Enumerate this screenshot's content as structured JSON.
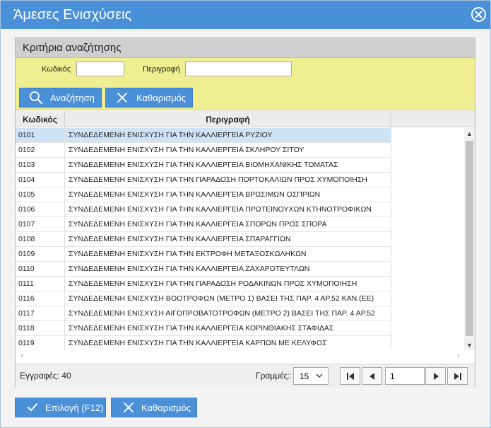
{
  "window": {
    "title": "Άμεσες Ενισχύσεις"
  },
  "criteria": {
    "header": "Κριτήρια αναζήτησης",
    "code_label": "Κωδικός",
    "code_value": "",
    "desc_label": "Περιγραφή",
    "desc_value": "",
    "search_button": "Αναζήτηση",
    "clear_button": "Καθαρισμός"
  },
  "grid": {
    "columns": [
      "Κωδικός",
      "Περιγραφή"
    ],
    "rows": [
      [
        "0101",
        "ΣΥΝΔΕΔΕΜΕΝΗ ΕΝΙΣΧΥΣΗ ΓΙΑ ΤΗΝ ΚΑΛΛΙΕΡΓΕΙΑ ΡΥΖΙΟΥ"
      ],
      [
        "0102",
        "ΣΥΝΔΕΔΕΜΕΝΗ ΕΝΙΣΧΥΣΗ ΓΙΑ ΤΗΝ ΚΑΛΛΙΕΡΓΕΙΑ ΣΚΛΗΡΟΥ ΣΙΤΟΥ"
      ],
      [
        "0103",
        "ΣΥΝΔΕΔΕΜΕΝΗ ΕΝΙΣΧΥΣΗ ΓΙΑ ΤΗΝ ΚΑΛΛΙΕΡΓΕΙΑ ΒΙΟΜΗΧΑΝΙΚΗΣ ΤΟΜΑΤΑΣ"
      ],
      [
        "0104",
        "ΣΥΝΔΕΔΕΜΕΝΗ ΕΝΙΣΧΥΣΗ ΓΙΑ ΤΗΝ ΠΑΡΑΔΟΣΗ ΠΟΡΤΟΚΑΛΙΩΝ ΠΡΟΣ ΧΥΜΟΠΟΙΗΣΗ"
      ],
      [
        "0105",
        "ΣΥΝΔΕΔΕΜΕΝΗ ΕΝΙΣΧΥΣΗ ΓΙΑ ΤΗΝ ΚΑΛΛΙΕΡΓΕΙΑ ΒΡΩΣΙΜΩΝ ΟΣΠΡΙΩΝ"
      ],
      [
        "0106",
        "ΣΥΝΔΕΔΕΜΕΝΗ ΕΝΙΣΧΥΣΗ ΓΙΑ ΤΗΝ ΚΑΛΛΙΕΡΓΕΙΑ ΠΡΩΤΕΙΝΟΥΧΩΝ ΚΤΗΝΟΤΡΟΦΙΚΩΝ"
      ],
      [
        "0107",
        "ΣΥΝΔΕΔΕΜΕΝΗ ΕΝΙΣΧΥΣΗ ΓΙΑ ΤΗΝ ΚΑΛΛΙΕΡΓΕΙΑ ΣΠΟΡΩΝ ΠΡΟΣ ΣΠΟΡΑ"
      ],
      [
        "0108",
        "ΣΥΝΔΕΔΕΜΕΝΗ ΕΝΙΣΧΥΣΗ ΓΙΑ ΤΗΝ ΚΑΛΛΙΕΡΓΕΙΑ ΣΠΑΡΑΓΓΙΩΝ"
      ],
      [
        "0109",
        "ΣΥΝΔΕΔΕΜΕΝΗ ΕΝΙΣΧΥΣΗ ΓΙΑ ΤΗΝ ΕΚΤΡΟΦΗ ΜΕΤΑΞΟΣΚΩΛΗΚΩΝ"
      ],
      [
        "0110",
        "ΣΥΝΔΕΔΕΜΕΝΗ ΕΝΙΣΧΥΣΗ ΓΙΑ ΤΗΝ ΚΑΛΛΙΕΡΓΕΙΑ ΖΑΧΑΡΟΤΕΥΤΛΩΝ"
      ],
      [
        "0111",
        "ΣΥΝΔΕΔΕΜΕΝΗ ΕΝΙΣΧΥΣΗ ΓΙΑ ΤΗΝ ΠΑΡΑΔΟΣΗ ΡΟΔΑΚΙΝΩΝ ΠΡΟΣ ΧΥΜΟΠΟΙΗΣΗ"
      ],
      [
        "0116",
        "ΣΥΝΔΕΔΕΜΕΝΗ ΕΝΙΣΧΥΣΗ ΒΟΟΤΡΟΦΩΝ (ΜΕΤΡΟ 1) ΒΑΣΕΙ ΤΗΣ ΠΑΡ. 4 ΑΡ.52 ΚΑΝ.(ΕΕ)"
      ],
      [
        "0117",
        "ΣΥΝΔΕΔΕΜΕΝΗ ΕΝΙΣΧΥΣΗ ΑΙΓΟΠΡΟΒΑΤΟΤΡΟΦΩΝ (ΜΕΤΡΟ 2) ΒΑΣΕΙ ΤΗΣ ΠΑΡ. 4 ΑΡ.52"
      ],
      [
        "0118",
        "ΣΥΝΔΕΔΕΜΕΝΗ ΕΝΙΣΧΥΣΗ ΓΙΑ ΤΗΝ ΚΑΛΛΙΕΡΓΕΙΑ ΚΟΡΙΝΘΙΑΚΗΣ ΣΤΑΦΙΔΑΣ"
      ],
      [
        "0119",
        "ΣΥΝΔΕΔΕΜΕΝΗ ΕΝΙΣΧΥΣΗ ΓΙΑ ΤΗΝ ΚΑΛΛΙΕΡΓΕΙΑ ΚΑΡΠΩΝ ΜΕ ΚΕΛΥΦΟΣ"
      ]
    ],
    "selected_row": 0
  },
  "footer": {
    "records_label": "Εγγραφές: 40",
    "rows_label": "Γραμμές:",
    "rows_per_page": "15",
    "page_value": "1"
  },
  "actions": {
    "select_button": "Επιλογή (F12)",
    "clear_button": "Καθαρισμός"
  },
  "colors": {
    "accent": "#4a90d9",
    "criteria_bg": "#efef91",
    "selected_row": "#cfe3f6"
  }
}
